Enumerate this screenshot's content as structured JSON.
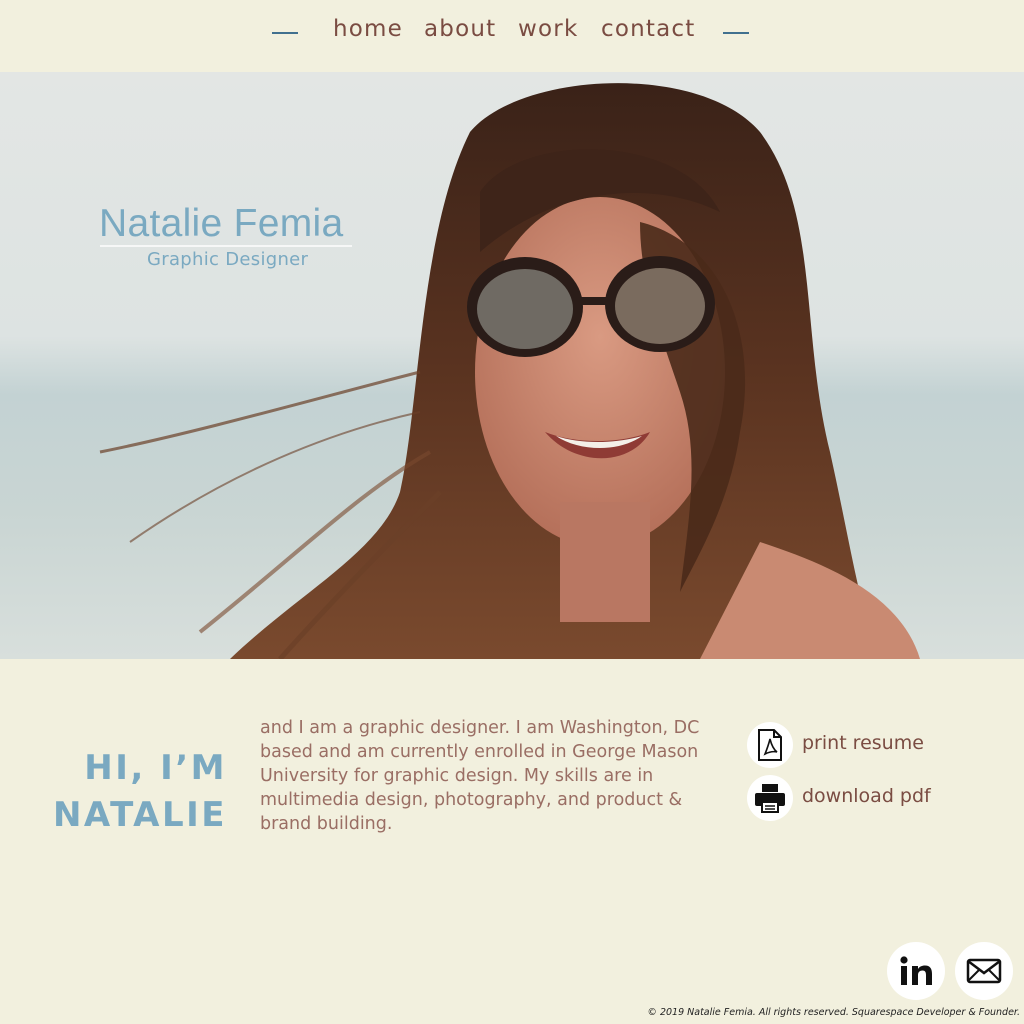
{
  "nav": {
    "links": [
      {
        "label": "home"
      },
      {
        "label": "about"
      },
      {
        "label": "work"
      },
      {
        "label": "contact"
      }
    ]
  },
  "hero": {
    "name": "Natalie Femia",
    "subtitle": "Graphic Designer"
  },
  "intro": {
    "heading_line1": "HI, I’M",
    "heading_line2": "NATALIE",
    "bio": "and I am a graphic designer. I am Washington, DC based and am currently enrolled in George Mason University for graphic design. My skills are in multimedia design, photography, and product & brand building."
  },
  "actions": [
    {
      "label": "print resume",
      "icon": "pdf-icon"
    },
    {
      "label": "download pdf",
      "icon": "printer-icon"
    }
  ],
  "social": [
    {
      "name": "linkedin",
      "icon": "linkedin-icon"
    },
    {
      "name": "email",
      "icon": "mail-icon"
    }
  ],
  "footer": {
    "text": "© 2019 Natalie Femia. All rights reserved. Squarespace Developer & Founder."
  },
  "colors": {
    "background": "#f2f0de",
    "nav_text": "#7a4c42",
    "accent_blue": "#7aa9c1",
    "dash": "#41708e",
    "body_text": "#9a6e64"
  }
}
